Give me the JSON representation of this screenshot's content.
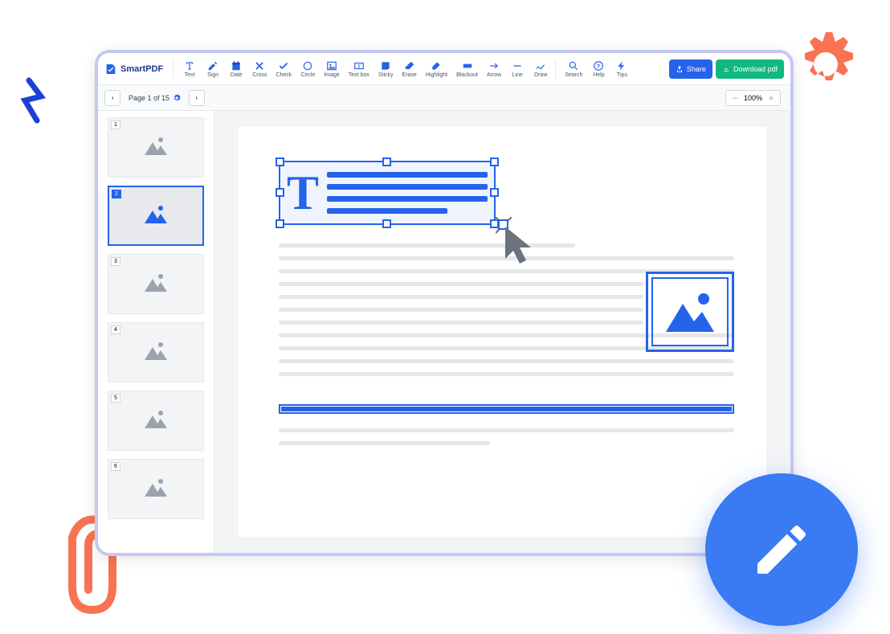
{
  "brand": "SmartPDF",
  "toolbar": {
    "groups": [
      {
        "id": "edit",
        "items": [
          {
            "id": "text",
            "label": "Text",
            "icon": "text"
          },
          {
            "id": "sign",
            "label": "Sign",
            "icon": "pen"
          },
          {
            "id": "date",
            "label": "Date",
            "icon": "calendar"
          },
          {
            "id": "cross",
            "label": "Cross",
            "icon": "cross"
          },
          {
            "id": "check",
            "label": "Check",
            "icon": "check"
          },
          {
            "id": "circle",
            "label": "Circle",
            "icon": "circle"
          },
          {
            "id": "image",
            "label": "Image",
            "icon": "image"
          },
          {
            "id": "textbox",
            "label": "Text box",
            "icon": "textbox"
          },
          {
            "id": "sticky",
            "label": "Sticky",
            "icon": "sticky"
          },
          {
            "id": "erase",
            "label": "Erase",
            "icon": "eraser"
          },
          {
            "id": "highlight",
            "label": "Highlight",
            "icon": "highlight"
          },
          {
            "id": "blackout",
            "label": "Blackout",
            "icon": "blackout"
          },
          {
            "id": "arrow",
            "label": "Arrow",
            "icon": "arrow"
          },
          {
            "id": "line",
            "label": "Line",
            "icon": "line"
          },
          {
            "id": "draw",
            "label": "Draw",
            "icon": "draw"
          }
        ]
      },
      {
        "id": "help",
        "items": [
          {
            "id": "search",
            "label": "Search",
            "icon": "search"
          },
          {
            "id": "help",
            "label": "Help",
            "icon": "help"
          },
          {
            "id": "tips",
            "label": "Tips",
            "icon": "tips"
          }
        ]
      }
    ],
    "share": "Share",
    "download": "Download pdf"
  },
  "page_nav": {
    "page_label": "Page 1 of 15"
  },
  "zoom": {
    "value": "100%"
  },
  "thumbnails": [
    {
      "num": "1",
      "selected": false
    },
    {
      "num": "2",
      "selected": true
    },
    {
      "num": "3",
      "selected": false
    },
    {
      "num": "4",
      "selected": false
    },
    {
      "num": "5",
      "selected": false
    },
    {
      "num": "6",
      "selected": false
    }
  ],
  "textbox_glyph": "T",
  "colors": {
    "primary": "#2563eb",
    "success": "#10b981",
    "accent_orange": "#f97352",
    "accent_blue": "#1d3fd8"
  }
}
